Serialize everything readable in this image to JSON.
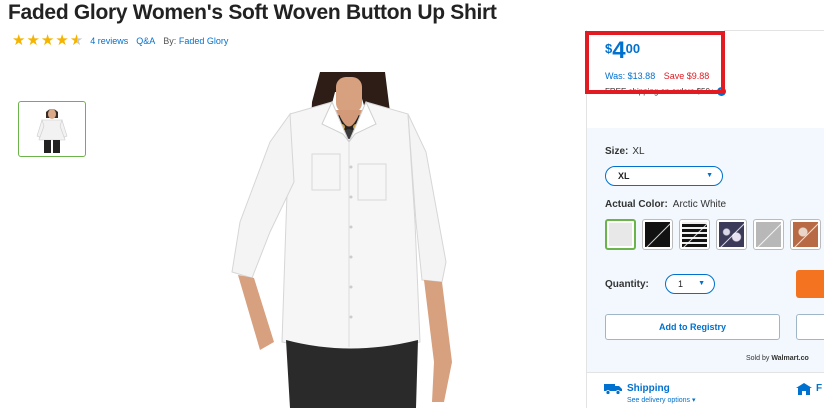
{
  "product": {
    "title": "Faded Glory Women's Soft Woven Button Up Shirt",
    "rating": 4.5,
    "reviews_link": "4 reviews",
    "qa_link": "Q&A",
    "by_label": "By:",
    "brand_link": "Faded Glory"
  },
  "price": {
    "currency": "$",
    "dollars": "4",
    "cents": "00",
    "was": "Was: $13.88",
    "save": "Save $9.88",
    "shipping_note": "FREE shipping on orders $50+"
  },
  "size": {
    "label": "Size:",
    "value": "XL",
    "select_value": "XL"
  },
  "color": {
    "label": "Actual Color:",
    "value": "Arctic White",
    "swatches": [
      {
        "name": "Arctic White",
        "selected": true,
        "color": "#e8e8e8"
      },
      {
        "name": "Black",
        "selected": false,
        "color": "#111111"
      },
      {
        "name": "Black White Stripe",
        "selected": false,
        "color": "#222222"
      },
      {
        "name": "Navy Floral",
        "selected": false,
        "color": "#3b3a58"
      },
      {
        "name": "Grey Print",
        "selected": false,
        "color": "#b8b8b8"
      },
      {
        "name": "Rust Print",
        "selected": false,
        "color": "#b86a45"
      }
    ]
  },
  "quantity": {
    "label": "Quantity:",
    "value": "1"
  },
  "buttons": {
    "registry": "Add to Registry"
  },
  "seller": {
    "prefix": "Sold by",
    "name": "Walmart.co"
  },
  "fulfillment": {
    "shipping_heading": "Shipping",
    "shipping_options": "See delivery options",
    "pickup_heading": "F"
  },
  "colors": {
    "link": "#0071ce",
    "save": "#de1c24",
    "highlight": "#e21b23",
    "cart": "#f47321",
    "selected_swatch": "#6bb34a"
  }
}
